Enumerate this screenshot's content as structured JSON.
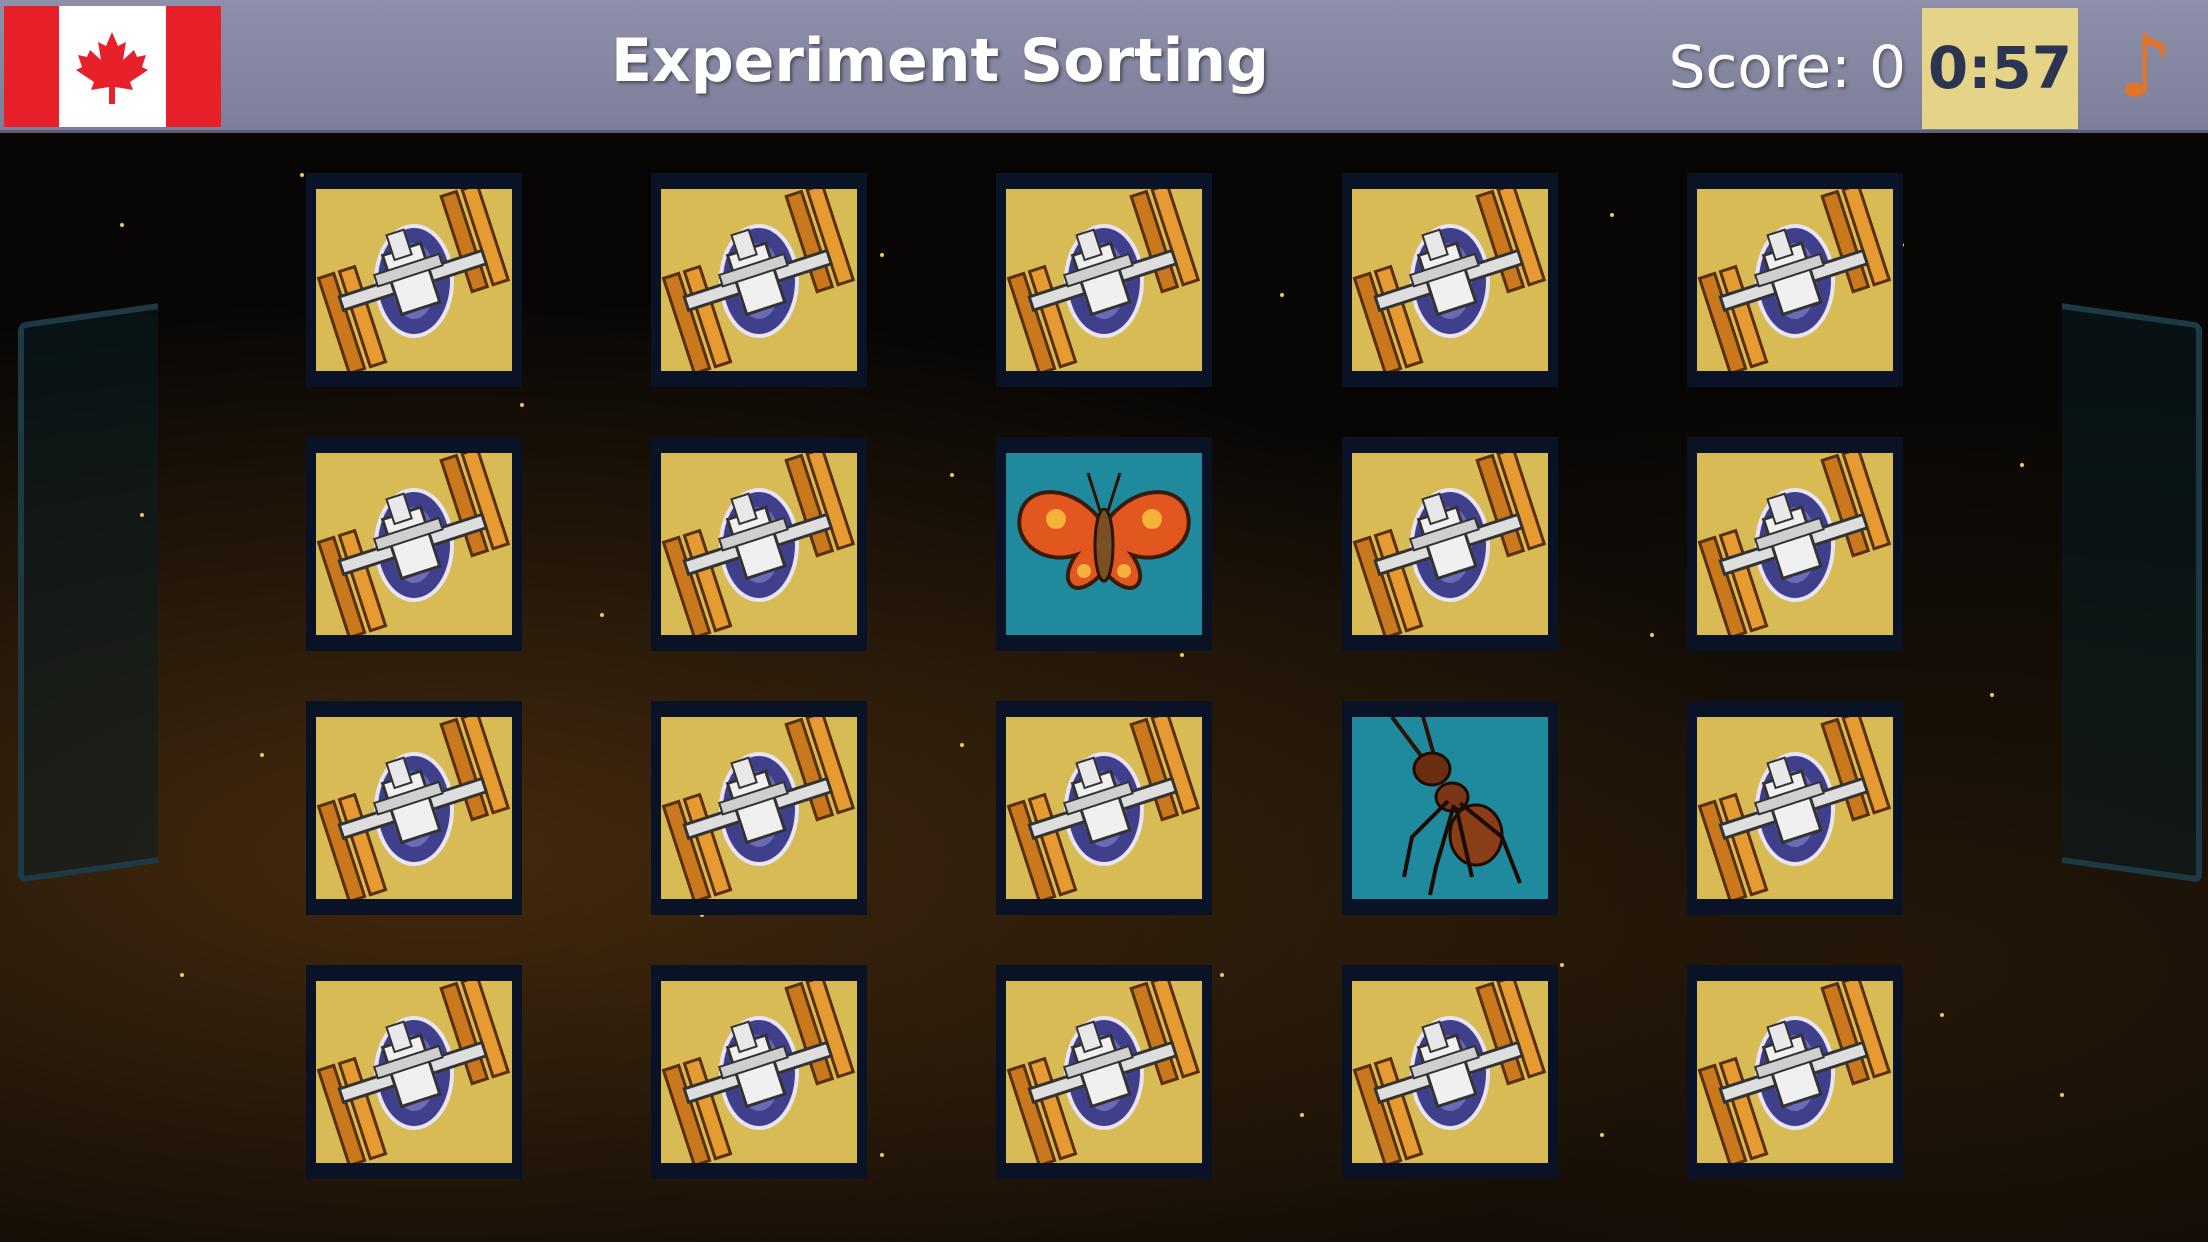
{
  "header": {
    "flag_icon": "canada-flag-icon",
    "title": "Experiment Sorting",
    "score_label": "Score: 0",
    "timer": "0:57",
    "music_icon": "music-note-icon"
  },
  "board": {
    "rows": 4,
    "cols": 5,
    "cards": [
      [
        "iss-back",
        "iss-back",
        "iss-back",
        "iss-back",
        "iss-back"
      ],
      [
        "iss-back",
        "iss-back",
        "butterfly",
        "iss-back",
        "iss-back"
      ],
      [
        "iss-back",
        "iss-back",
        "iss-back",
        "ant",
        "iss-back"
      ],
      [
        "iss-back",
        "iss-back",
        "iss-back",
        "iss-back",
        "iss-back"
      ]
    ]
  },
  "colors": {
    "header_bg": "#8e8fa9",
    "timer_bg": "#e5d388",
    "card_back": "#d9bb55",
    "card_face": "#1f8a9e",
    "music_note": "#e0752a"
  }
}
